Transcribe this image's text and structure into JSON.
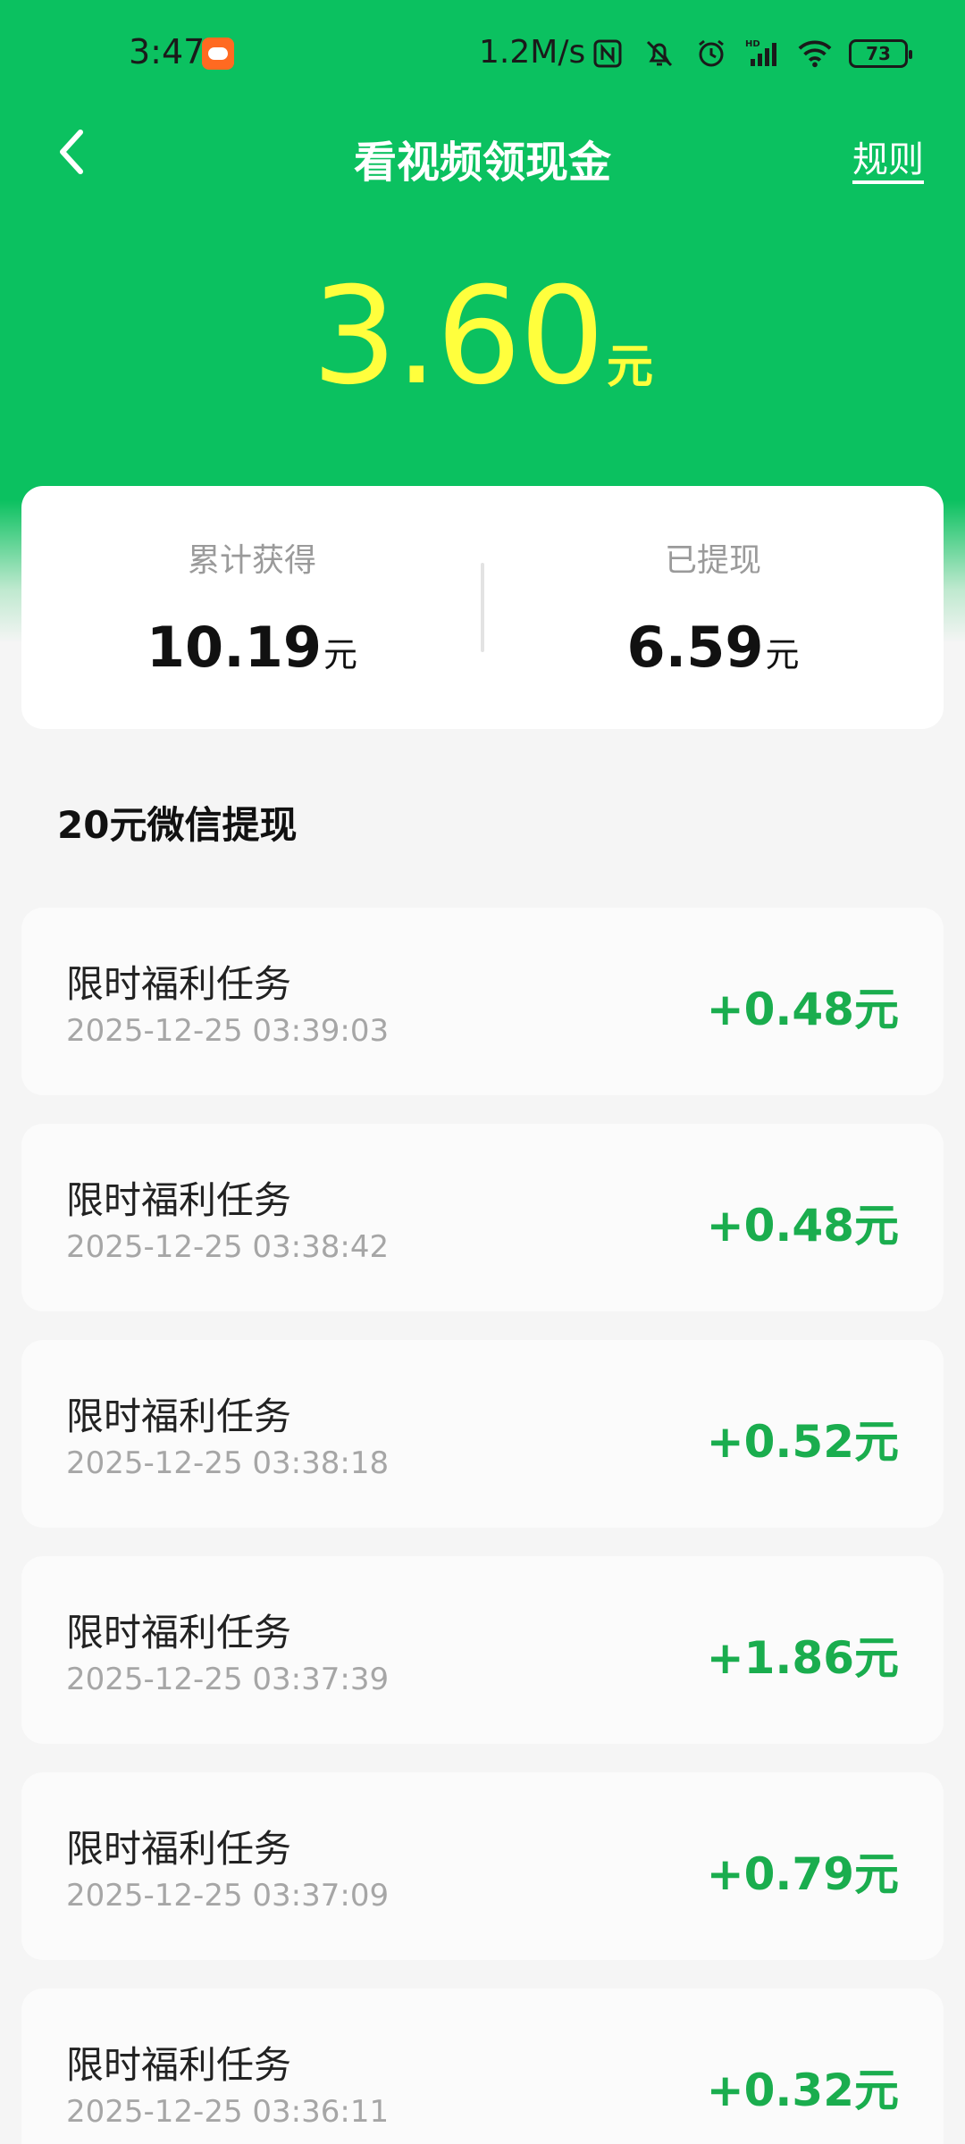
{
  "status_bar": {
    "time": "3:47",
    "speed": "1.2M/s",
    "battery": "73",
    "icons": [
      "nfc-icon",
      "mute-bell-icon",
      "alarm-icon",
      "hd-signal-icon",
      "wifi-icon",
      "battery-icon"
    ]
  },
  "header": {
    "title": "看视频领现金",
    "rules_label": "规则"
  },
  "balance": {
    "amount": "3.60",
    "unit": "元"
  },
  "summary": {
    "total": {
      "label": "累计获得",
      "value": "10.19",
      "unit": "元"
    },
    "withdrawn": {
      "label": "已提现",
      "value": "6.59",
      "unit": "元"
    }
  },
  "section_title": "20元微信提现",
  "tasks": [
    {
      "name": "限时福利任务",
      "time": "2025-12-25 03:39:03",
      "amount": "+0.48元"
    },
    {
      "name": "限时福利任务",
      "time": "2025-12-25 03:38:42",
      "amount": "+0.48元"
    },
    {
      "name": "限时福利任务",
      "time": "2025-12-25 03:38:18",
      "amount": "+0.52元"
    },
    {
      "name": "限时福利任务",
      "time": "2025-12-25 03:37:39",
      "amount": "+1.86元"
    },
    {
      "name": "限时福利任务",
      "time": "2025-12-25 03:37:09",
      "amount": "+0.79元"
    },
    {
      "name": "限时福利任务",
      "time": "2025-12-25 03:36:11",
      "amount": "+0.32元"
    }
  ],
  "colors": {
    "brand_green": "#0bc160",
    "balance_yellow": "#ffff3d",
    "amount_green": "#1aad4e"
  }
}
